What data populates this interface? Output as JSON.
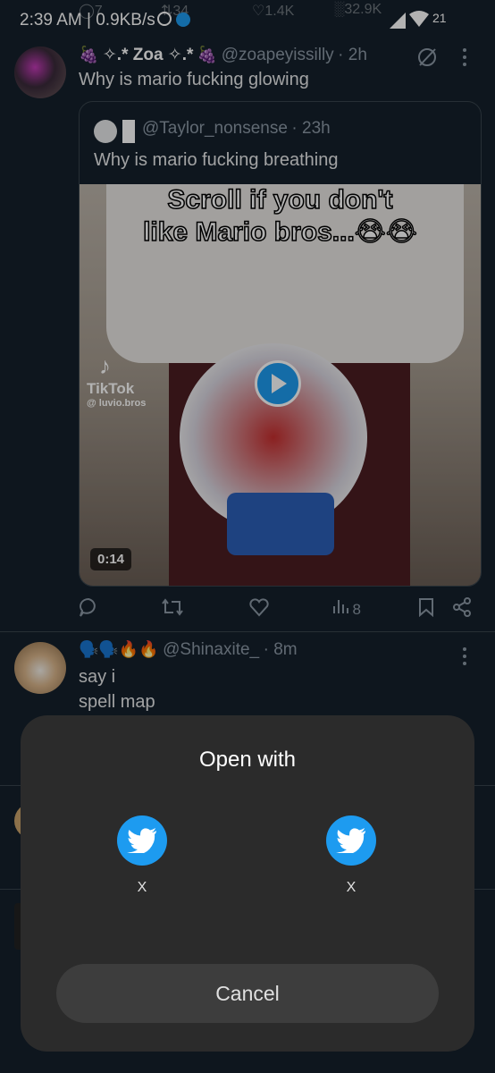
{
  "status_bar": {
    "time": "2:39 AM",
    "speed": "0.9KB/s",
    "battery": "21"
  },
  "previous_tweet_counts": {
    "replies": "7",
    "retweets": "34",
    "likes": "1.4K",
    "views": "32.9K"
  },
  "tweet1": {
    "name": "✧.* Zoa ✧.*",
    "handle": "@zoapeyissilly",
    "time": "· 2h",
    "text": "Why is mario fucking glowing",
    "quote": {
      "handle": "@Taylor_nonsense",
      "time": "· 23h",
      "text": "Why is mario fucking breathing",
      "video": {
        "caption_line1": "Scroll if you don't",
        "caption_line2": "like Mario bros...😭😭",
        "watermark": "TikTok",
        "watermark_handle": "@ luvio.bros",
        "duration": "0:14"
      }
    },
    "actions": {
      "views": "8"
    }
  },
  "tweet2": {
    "emojis": "🗣️🗣️🔥🔥",
    "handle": "@Shinaxite_",
    "time": "· 8m",
    "line1": "say i",
    "line2": "spell map"
  },
  "open_with_sheet": {
    "title": "Open with",
    "apps": [
      {
        "label": "X",
        "icon": "twitter-bird-icon"
      },
      {
        "label": "X",
        "icon": "twitter-bird-icon"
      }
    ],
    "cancel": "Cancel"
  },
  "colors": {
    "background": "#15202b",
    "twitter_blue": "#1d9bf0",
    "sheet": "#2b2b2b",
    "cancel_button": "#3d3d3d"
  }
}
